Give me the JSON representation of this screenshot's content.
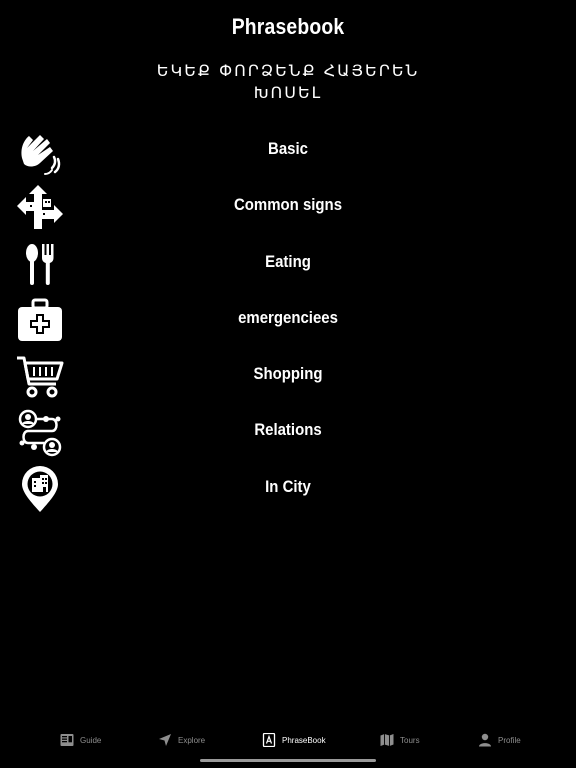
{
  "header": {
    "title": "Phrasebook",
    "subtitle": "ԵԿԵՔ ՓՈՐՁԵՆՔ ՀԱՅԵՐԵՆ ԽՈՍԵԼ"
  },
  "categories": [
    {
      "label": "Basic",
      "icon": "waving-hand-icon"
    },
    {
      "label": "Common signs",
      "icon": "direction-signs-icon"
    },
    {
      "label": "Eating",
      "icon": "spoon-fork-icon"
    },
    {
      "label": "emergenciees",
      "icon": "first-aid-kit-icon"
    },
    {
      "label": "Shopping",
      "icon": "shopping-cart-icon"
    },
    {
      "label": "Relations",
      "icon": "people-connections-icon"
    },
    {
      "label": "In City",
      "icon": "city-location-pin-icon"
    }
  ],
  "tabbar": {
    "items": [
      {
        "label": "Guide",
        "icon": "guide-book-icon",
        "active": false
      },
      {
        "label": "Explore",
        "icon": "navigation-arrow-icon",
        "active": false
      },
      {
        "label": "PhraseBook",
        "icon": "phrasebook-icon",
        "active": true
      },
      {
        "label": "Tours",
        "icon": "map-icon",
        "active": false
      },
      {
        "label": "Profile",
        "icon": "person-icon",
        "active": false
      }
    ]
  },
  "colors": {
    "background": "#000000",
    "text": "#ffffff",
    "inactive_tab": "#8e8e8e"
  }
}
